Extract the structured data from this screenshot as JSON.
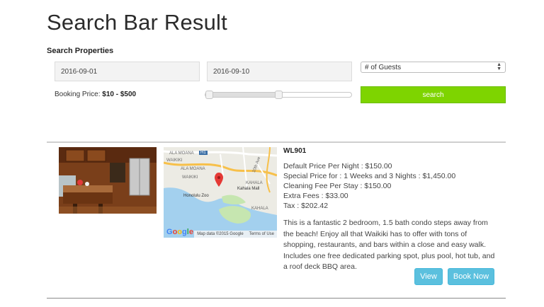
{
  "page": {
    "title": "Search Bar Result",
    "section_label": "Search Properties"
  },
  "search": {
    "checkin_value": "2016-09-01",
    "checkout_value": "2016-09-10",
    "guests_selected": "# of Guests",
    "price_label": "Booking Price:",
    "price_range": "$10 - $500",
    "slider_min_fraction": 0,
    "slider_max_fraction": 0.5,
    "search_label": "search",
    "search_color": "#7ed400"
  },
  "listing": {
    "code": "WL901",
    "prices": [
      "Default Price Per Night : $150.00",
      "Special Price for : 1 Weeks and 3 Nights : $1,450.00",
      "Cleaning Fee Per Stay : $150.00",
      "Extra Fees : $33.00",
      "Tax : $202.42"
    ],
    "description": "This is a fantastic 2 bedroom, 1.5 bath condo steps away from the beach! Enjoy all that Waikiki has to offer with tons of shopping, restaurants, and bars within a close and easy walk. Includes one free dedicated parking spot, plus pool, hot tub, and a roof deck BBQ area.",
    "view_label": "View",
    "book_label": "Book Now",
    "button_color": "#5bc0de"
  },
  "map": {
    "labels": {
      "ala_moana_1": "ALA MOANA",
      "ala_moana_2": "ALA MOANA",
      "waikiki_1": "WAIKIKI",
      "waikiki_2": "WAIKIKI",
      "kahala_1": "KAHALA",
      "kahala_2": "KAHALA",
      "kahala_mall": "Kahala Mall",
      "honolulu_zoo": "Honolulu Zoo",
      "highway_h1": "H1",
      "street_10th": "10th Ave"
    },
    "data_credit": "Map data ©2015 Google",
    "terms": "Terms of Use",
    "logo": "Google"
  }
}
